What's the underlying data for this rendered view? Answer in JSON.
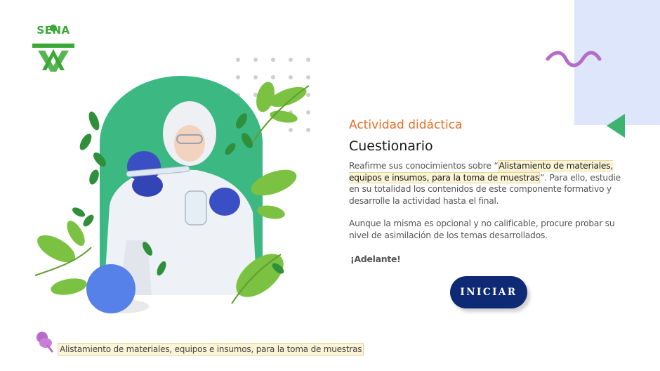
{
  "logo": {
    "text": "SENA",
    "color": "#39a935"
  },
  "activity": {
    "subtitle": "Actividad didáctica",
    "title": "Cuestionario",
    "para1_before": "Reafirme sus conocimientos sobre “",
    "para1_highlight": "Alistamiento de materiales, equipos e insumos, para la toma de muestras",
    "para1_after": "”.  Para ello, estudie en su totalidad los contenidos de este componente formativo y desarrolle la actividad hasta el final.",
    "para2": "Aunque la misma es opcional y no calificable, procure probar su nivel de asimilación de los temas desarrollados.",
    "cheer": "¡Adelante!"
  },
  "start_button": {
    "label": "INICIAR",
    "color": "#0e2a74"
  },
  "footer": {
    "text": "Alistamiento de materiales, equipos e insumos, para la toma de muestras"
  },
  "colors": {
    "accent_orange": "#e96f25",
    "arch_green": "#3cb983",
    "leaf_green": "#7cc242",
    "circle_blue": "#5681e8",
    "squiggle_purple": "#b66ac9",
    "triangle_green": "#3cb371",
    "panel_blue": "#dde6fb"
  }
}
